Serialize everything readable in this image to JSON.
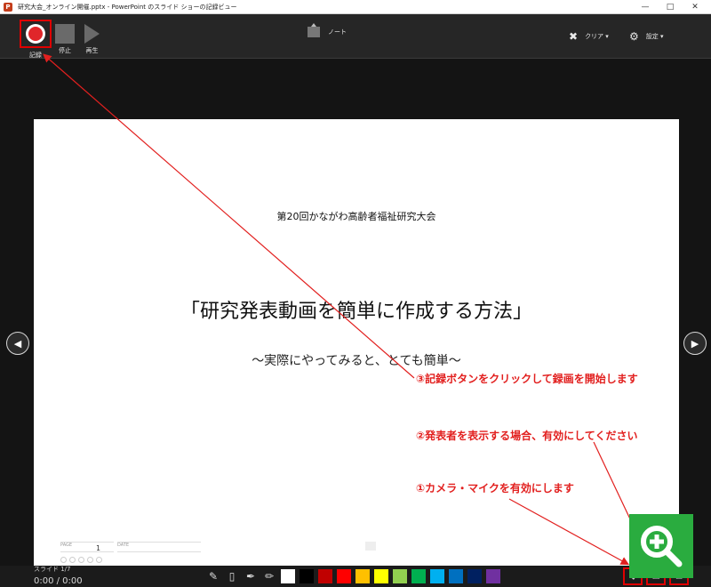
{
  "window": {
    "title": "研究大会_オンライン開催.pptx - PowerPoint のスライド ショーの記録ビュー",
    "app_icon": "P"
  },
  "toolbar": {
    "record_label": "記録",
    "stop_label": "停止",
    "play_label": "再生",
    "note_label": "ノート",
    "clear_label": "クリア ▾",
    "settings_label": "設定 ▾"
  },
  "slide": {
    "conference": "第20回かながわ高齢者福祉研究大会",
    "title": "「研究発表動画を簡単に作成する方法」",
    "subtitle": "～実際にやってみると、とても簡単～",
    "page_label": "PAGE",
    "page_value": "1",
    "date_label": "DATE"
  },
  "annotations": {
    "step3": "③記録ボタンをクリックして録画を開始します",
    "step2": "②発表者を表示する場合、有効にしてください",
    "step1": "①カメラ・マイクを有効にします"
  },
  "status": {
    "slide_count": "スライド 1/7",
    "timer": "0:00 / 0:00"
  },
  "pen_colors": [
    "#ffffff",
    "#000000",
    "#c00000",
    "#ff0000",
    "#ffc000",
    "#ffff00",
    "#92d050",
    "#00b050",
    "#00b0f0",
    "#0070c0",
    "#002060",
    "#7030a0"
  ],
  "colors": {
    "accent_red": "#e2201f",
    "zoom_green": "#2aac3f"
  },
  "icons": {
    "prev": "chevron-left-icon",
    "next": "chevron-right-icon",
    "zoom": "zoom-in-icon"
  }
}
